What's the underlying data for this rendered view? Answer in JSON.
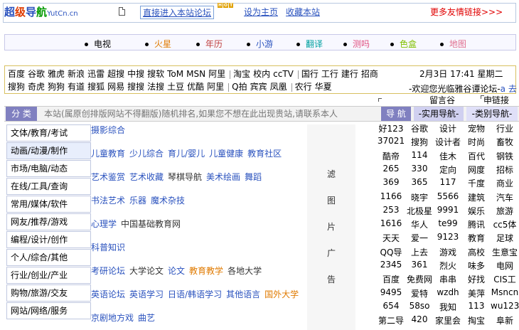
{
  "header": {
    "logo_cn": [
      "超",
      "级",
      "导",
      "航"
    ],
    "logo_en": "YutCn.cn",
    "enter_link": "直接进入本站论坛",
    "hot_badge": [
      "H",
      "O",
      "T"
    ],
    "home_link": "设为主页",
    "fav_link": "收藏本站",
    "more_links": "更多友情链接>>>"
  },
  "categories": [
    "电视",
    "火星",
    "年历",
    "小游",
    "翻译",
    "测吗",
    "色盒",
    "地图"
  ],
  "category_colors": [
    "#000000",
    "#e07a00",
    "#c04040",
    "#2a52be",
    "#00a0a0",
    "#e05080",
    "#80c000",
    "#e07090"
  ],
  "link_row1": [
    "百度",
    "谷歌",
    "雅虎",
    "新浪",
    "迅雷",
    "超搜",
    "中搜",
    "搜软",
    "ToM",
    "MSN",
    "阿里",
    "淘宝",
    "校内",
    "ccTV",
    "国行",
    "工行",
    "建行",
    "招商"
  ],
  "link_row2": [
    "搜狗",
    "奇虎",
    "狗狗",
    "有道",
    "搜狐",
    "网易",
    "搜搜",
    "法搜",
    "土豆",
    "优酷",
    "阿里",
    "Q拍",
    "宾宾",
    "凤凰",
    "农行",
    "华夏"
  ],
  "date_text": "2月3日 17:41 星期二",
  "welcome_text": "-欢迎您光临雅谷谭论坛-",
  "welcome_link": "a 去",
  "liuyan": "留言谷",
  "friend_links": "申链接",
  "search": {
    "cat_label": "分 类",
    "placeholder": "本站(属原创排版网站不得翻版)随机排名,如果您不想在此出现贵站,请联系本人",
    "nav_label": "导 航",
    "util_nav": "-实用导航-",
    "type_nav": "-类别导航-"
  },
  "menu": [
    "文体/教育/考试",
    "动画/动漫/制作",
    "市场/电脑/动态",
    "在线/工具/查询",
    "常用/媒体/软件",
    "网友/推荐/游戏",
    "编程/设计/创作",
    "个人/综合/其他",
    "行业/创业/产业",
    "购物/旅游/交友",
    "网站/网络/服务"
  ],
  "content": [
    [
      [
        "摄影综合",
        "b"
      ]
    ],
    [
      [
        "儿童教育",
        "b"
      ],
      [
        "少儿综合",
        "b"
      ],
      [
        "育儿/婴儿",
        "b"
      ],
      [
        "儿童健康",
        "b"
      ],
      [
        "教育社区",
        "b"
      ]
    ],
    [
      [
        "艺术鉴赏",
        "b"
      ],
      [
        "艺术收藏",
        "b"
      ],
      [
        "琴棋导航",
        "d"
      ],
      [
        "美术绘画",
        "b"
      ],
      [
        "舞蹈",
        "b"
      ]
    ],
    [
      [
        "书法艺术",
        "b"
      ],
      [
        "乐器",
        "b"
      ],
      [
        "魔术杂技",
        "b"
      ]
    ],
    [
      [
        "心理学",
        "b"
      ],
      [
        "中国基础教育网",
        "d"
      ]
    ],
    [
      [
        "科普知识",
        "b"
      ]
    ],
    [
      [
        "考研论坛",
        "b"
      ],
      [
        "大学论文",
        "d"
      ],
      [
        "论文",
        "b"
      ],
      [
        "教育教学",
        "o"
      ],
      [
        "各地大学",
        "d"
      ]
    ],
    [
      [
        "英语论坛",
        "b"
      ],
      [
        "英语学习",
        "b"
      ],
      [
        "日语/韩语学习",
        "b"
      ],
      [
        "其他语言",
        "b"
      ],
      [
        "国外大学",
        "o"
      ]
    ],
    [
      [
        "京剧地方戏",
        "b"
      ],
      [
        "曲艺",
        "b"
      ]
    ]
  ],
  "ad_chars": [
    "滤",
    "图",
    "片",
    "广",
    "告"
  ],
  "right_table": [
    [
      "好123",
      "谷歌",
      "设计",
      "宠物",
      "行业"
    ],
    [
      "37021",
      "搜狗",
      "设计者",
      "时尚",
      "畜牧"
    ],
    [
      "酷帝",
      "114",
      "佳木",
      "百代",
      "钢铁"
    ],
    [
      "265",
      "330",
      "定向",
      "网度",
      "招标"
    ],
    [
      "369",
      "365",
      "117",
      "千度",
      "商业"
    ],
    [
      "1166",
      "晓宇",
      "5566",
      "建筑",
      "汽车"
    ],
    [
      "253",
      "北极星",
      "9991",
      "娱乐",
      "旅游"
    ],
    [
      "1616",
      "华人",
      "te99",
      "腾讯",
      "cc5体"
    ],
    [
      "天天",
      "爱一",
      "9123",
      "教育",
      "足球"
    ],
    [
      "QQ导",
      "上去",
      "游戏",
      "高校",
      "生意宝"
    ],
    [
      "2345",
      "361",
      "烈火",
      "味多",
      "电网"
    ],
    [
      "百度",
      "免费网",
      "串串",
      "好找",
      "CIS工"
    ],
    [
      "9495",
      "爱特",
      "wzdh",
      "美萍",
      "Msncn"
    ],
    [
      "654",
      "58so",
      "我知",
      "113",
      "wu123"
    ],
    [
      "第二导",
      "420",
      "家里会",
      "掏宝",
      "阜新"
    ]
  ]
}
